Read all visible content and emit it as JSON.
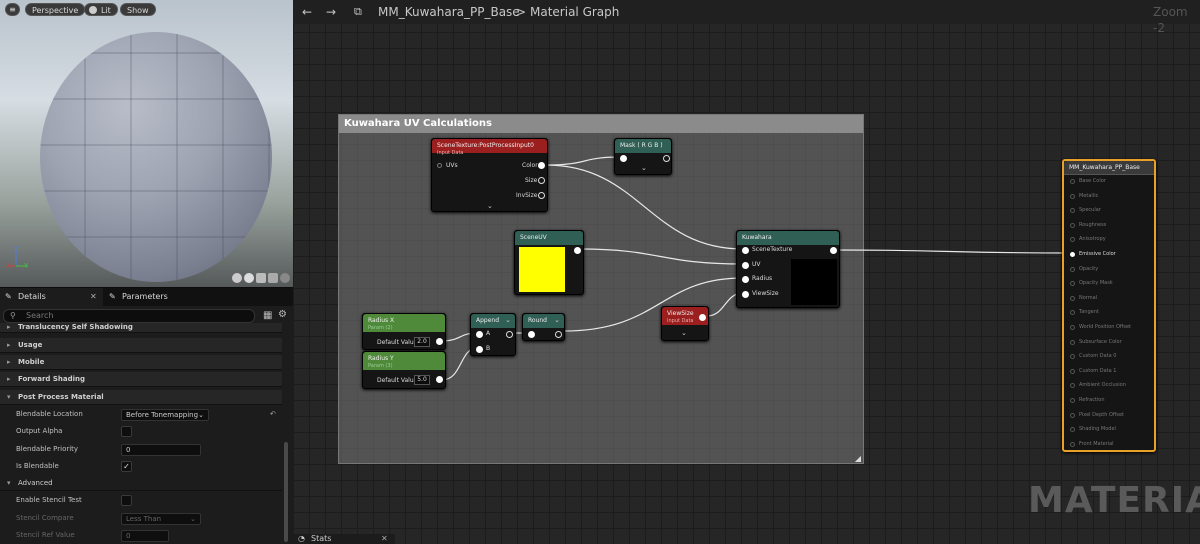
{
  "viewport": {
    "buttons": [
      "Perspective",
      "Lit",
      "Show"
    ],
    "axis_labels": [
      "Z",
      "X",
      "Y"
    ]
  },
  "details": {
    "tabs": [
      "Details",
      "Parameters"
    ],
    "search_placeholder": "Search",
    "categories": [
      {
        "label": "Translucency Self Shadowing"
      },
      {
        "label": "Usage"
      },
      {
        "label": "Mobile"
      },
      {
        "label": "Forward Shading"
      },
      {
        "label": "Post Process Material"
      }
    ],
    "props": {
      "blendable_location": {
        "label": "Blendable Location",
        "value": "Before Tonemapping"
      },
      "output_alpha": {
        "label": "Output Alpha"
      },
      "blendable_priority": {
        "label": "Blendable Priority",
        "value": "0"
      },
      "is_blendable": {
        "label": "Is Blendable",
        "check": "✓"
      },
      "advanced": {
        "label": "Advanced"
      },
      "enable_stencil": {
        "label": "Enable Stencil Test"
      },
      "stencil_compare": {
        "label": "Stencil Compare",
        "value": "Less Than"
      },
      "stencil_ref": {
        "label": "Stencil Ref Value",
        "value": "0"
      }
    }
  },
  "graph": {
    "breadcrumb_asset": "MM_Kuwahara_PP_Base",
    "breadcrumb_sep": ">",
    "breadcrumb_view": "Material Graph",
    "zoom": "Zoom -2",
    "comment_title": "Kuwahara UV Calculations",
    "watermark": "MATERIAL",
    "stats_tab": "Stats",
    "nodes": {
      "scene_texture": {
        "title": "SceneTexture:PostProcessInput0",
        "sub": "Input Data",
        "in": "UVs",
        "outs": [
          "Color",
          "Size",
          "InvSize"
        ]
      },
      "mask": {
        "title": "Mask ( R G B )"
      },
      "scene_uv": {
        "title": "SceneUV"
      },
      "kuwahara": {
        "title": "Kuwahara",
        "ins": [
          "SceneTexture",
          "UV",
          "Radius",
          "ViewSize"
        ]
      },
      "radius_x": {
        "title": "Radius X",
        "sub": "Param (2)",
        "label": "Default Value",
        "value": "2.0"
      },
      "radius_y": {
        "title": "Radius Y",
        "sub": "Param (3)",
        "label": "Default Value",
        "value": "5.0"
      },
      "append": {
        "title": "Append",
        "ins": [
          "A",
          "B"
        ]
      },
      "round": {
        "title": "Round"
      },
      "view_size": {
        "title": "ViewSize",
        "sub": "Input Data"
      },
      "output": {
        "title": "MM_Kuwahara_PP_Base",
        "pins": [
          "Base Color",
          "Metallic",
          "Specular",
          "Roughness",
          "Anisotropy",
          "Emissive Color",
          "Opacity",
          "Opacity Mask",
          "Normal",
          "Tangent",
          "World Position Offset",
          "Subsurface Color",
          "Custom Data 0",
          "Custom Data 1",
          "Ambient Occlusion",
          "Refraction",
          "Pixel Depth Offset",
          "Shading Model",
          "Front Material"
        ],
        "active_index": 5
      }
    }
  },
  "colors": {
    "param_green": "#4f8a3a",
    "texture_red": "#9b1f1f",
    "function_teal": "#2f5f55",
    "selected_orange": "#e8a028",
    "scene_uv_preview": "#ffff00"
  }
}
